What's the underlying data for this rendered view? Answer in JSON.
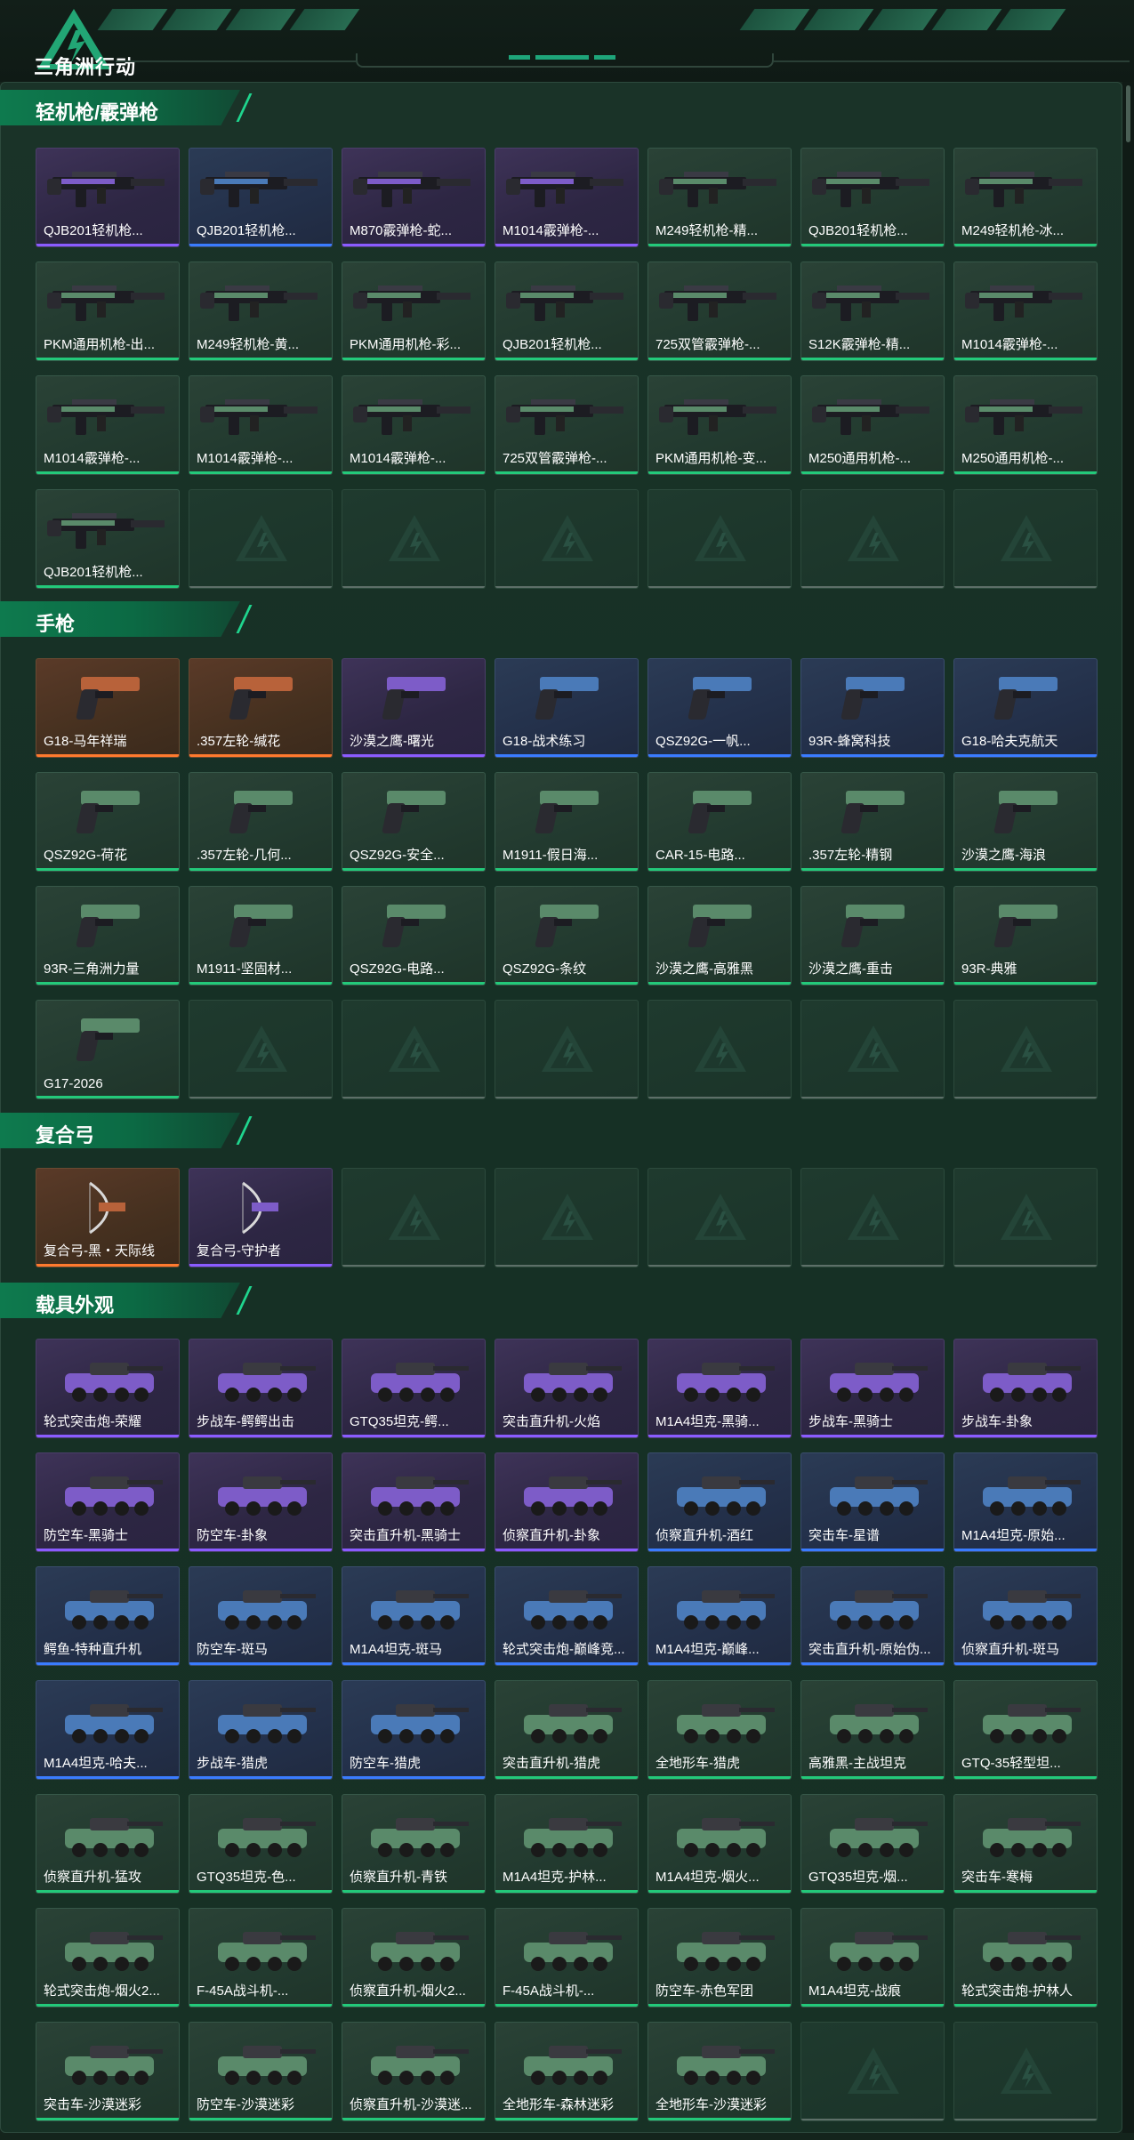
{
  "header": {
    "logo_text": "三角洲行动",
    "brand_color": "#1ea57a"
  },
  "rarity_colors": {
    "purple": "#8a5cff",
    "blue": "#3a7cff",
    "green": "#23c97a",
    "orange": "#ff7a2e"
  },
  "sections": [
    {
      "title": "轻机枪/霰弹枪",
      "icon": "gun-icon",
      "items": [
        {
          "name": "QJB201轻机枪...",
          "rarity": "purple"
        },
        {
          "name": "QJB201轻机枪...",
          "rarity": "blue"
        },
        {
          "name": "M870霰弹枪-蛇...",
          "rarity": "purple"
        },
        {
          "name": "M1014霰弹枪-...",
          "rarity": "purple"
        },
        {
          "name": "M249轻机枪-精...",
          "rarity": "green"
        },
        {
          "name": "QJB201轻机枪...",
          "rarity": "green"
        },
        {
          "name": "M249轻机枪-冰...",
          "rarity": "green"
        },
        {
          "name": "PKM通用机枪-出...",
          "rarity": "green"
        },
        {
          "name": "M249轻机枪-黄...",
          "rarity": "green"
        },
        {
          "name": "PKM通用机枪-彩...",
          "rarity": "green"
        },
        {
          "name": "QJB201轻机枪...",
          "rarity": "green"
        },
        {
          "name": "725双管霰弹枪-...",
          "rarity": "green"
        },
        {
          "name": "S12K霰弹枪-精...",
          "rarity": "green"
        },
        {
          "name": "M1014霰弹枪-...",
          "rarity": "green"
        },
        {
          "name": "M1014霰弹枪-...",
          "rarity": "green"
        },
        {
          "name": "M1014霰弹枪-...",
          "rarity": "green"
        },
        {
          "name": "M1014霰弹枪-...",
          "rarity": "green"
        },
        {
          "name": "725双管霰弹枪-...",
          "rarity": "green"
        },
        {
          "name": "PKM通用机枪-变...",
          "rarity": "green"
        },
        {
          "name": "M250通用机枪-...",
          "rarity": "green"
        },
        {
          "name": "M250通用机枪-...",
          "rarity": "green"
        },
        {
          "name": "QJB201轻机枪...",
          "rarity": "green"
        }
      ]
    },
    {
      "title": "手枪",
      "icon": "pistol-icon",
      "items": [
        {
          "name": "G18-马年祥瑞",
          "rarity": "orange"
        },
        {
          "name": ".357左轮-缄花",
          "rarity": "orange"
        },
        {
          "name": "沙漠之鹰-曙光",
          "rarity": "purple"
        },
        {
          "name": "G18-战术练习",
          "rarity": "blue"
        },
        {
          "name": "QSZ92G-一帆...",
          "rarity": "blue"
        },
        {
          "name": "93R-蜂窝科技",
          "rarity": "blue"
        },
        {
          "name": "G18-哈夫克航天",
          "rarity": "blue"
        },
        {
          "name": "QSZ92G-荷花",
          "rarity": "green"
        },
        {
          "name": ".357左轮-几何...",
          "rarity": "green"
        },
        {
          "name": "QSZ92G-安全...",
          "rarity": "green"
        },
        {
          "name": "M1911-假日海...",
          "rarity": "green"
        },
        {
          "name": "CAR-15-电路...",
          "rarity": "green"
        },
        {
          "name": ".357左轮-精钢",
          "rarity": "green"
        },
        {
          "name": "沙漠之鹰-海浪",
          "rarity": "green"
        },
        {
          "name": "93R-三角洲力量",
          "rarity": "green"
        },
        {
          "name": "M1911-坚固材...",
          "rarity": "green"
        },
        {
          "name": "QSZ92G-电路...",
          "rarity": "green"
        },
        {
          "name": "QSZ92G-条纹",
          "rarity": "green"
        },
        {
          "name": "沙漠之鹰-高雅黑",
          "rarity": "green"
        },
        {
          "name": "沙漠之鹰-重击",
          "rarity": "green"
        },
        {
          "name": "93R-典雅",
          "rarity": "green"
        },
        {
          "name": "G17-2026",
          "rarity": "green"
        }
      ]
    },
    {
      "title": "复合弓",
      "icon": "bow-icon",
      "items": [
        {
          "name": "复合弓-黑・天际线",
          "rarity": "orange"
        },
        {
          "name": "复合弓-守护者",
          "rarity": "purple"
        }
      ]
    },
    {
      "title": "载具外观",
      "icon": "vehicle-icon",
      "items": [
        {
          "name": "轮式突击炮-荣耀",
          "rarity": "purple"
        },
        {
          "name": "步战车-鳄鳄出击",
          "rarity": "purple"
        },
        {
          "name": "GTQ35坦克-鳄...",
          "rarity": "purple"
        },
        {
          "name": "突击直升机-火焰",
          "rarity": "purple"
        },
        {
          "name": "M1A4坦克-黑骑...",
          "rarity": "purple"
        },
        {
          "name": "步战车-黑骑士",
          "rarity": "purple"
        },
        {
          "name": "步战车-卦象",
          "rarity": "purple"
        },
        {
          "name": "防空车-黑骑士",
          "rarity": "purple"
        },
        {
          "name": "防空车-卦象",
          "rarity": "purple"
        },
        {
          "name": "突击直升机-黑骑士",
          "rarity": "purple"
        },
        {
          "name": "侦察直升机-卦象",
          "rarity": "purple"
        },
        {
          "name": "侦察直升机-酒红",
          "rarity": "blue"
        },
        {
          "name": "突击车-星谱",
          "rarity": "blue"
        },
        {
          "name": "M1A4坦克-原始...",
          "rarity": "blue"
        },
        {
          "name": "鳄鱼-特种直升机",
          "rarity": "blue"
        },
        {
          "name": "防空车-斑马",
          "rarity": "blue"
        },
        {
          "name": "M1A4坦克-斑马",
          "rarity": "blue"
        },
        {
          "name": "轮式突击炮-巅峰竞...",
          "rarity": "blue"
        },
        {
          "name": "M1A4坦克-巅峰...",
          "rarity": "blue"
        },
        {
          "name": "突击直升机-原始伪...",
          "rarity": "blue"
        },
        {
          "name": "侦察直升机-斑马",
          "rarity": "blue"
        },
        {
          "name": "M1A4坦克-哈夫...",
          "rarity": "blue"
        },
        {
          "name": "步战车-猎虎",
          "rarity": "blue"
        },
        {
          "name": "防空车-猎虎",
          "rarity": "blue"
        },
        {
          "name": "突击直升机-猎虎",
          "rarity": "green"
        },
        {
          "name": "全地形车-猎虎",
          "rarity": "green"
        },
        {
          "name": "高雅黑-主战坦克",
          "rarity": "green"
        },
        {
          "name": "GTQ-35轻型坦...",
          "rarity": "green"
        },
        {
          "name": "侦察直升机-猛攻",
          "rarity": "green"
        },
        {
          "name": "GTQ35坦克-色...",
          "rarity": "green"
        },
        {
          "name": "侦察直升机-青铁",
          "rarity": "green"
        },
        {
          "name": "M1A4坦克-护林...",
          "rarity": "green"
        },
        {
          "name": "M1A4坦克-烟火...",
          "rarity": "green"
        },
        {
          "name": "GTQ35坦克-烟...",
          "rarity": "green"
        },
        {
          "name": "突击车-寒梅",
          "rarity": "green"
        },
        {
          "name": "轮式突击炮-烟火2...",
          "rarity": "green"
        },
        {
          "name": "F-45A战斗机-...",
          "rarity": "green"
        },
        {
          "name": "侦察直升机-烟火2...",
          "rarity": "green"
        },
        {
          "name": "F-45A战斗机-...",
          "rarity": "green"
        },
        {
          "name": "防空车-赤色军团",
          "rarity": "green"
        },
        {
          "name": "M1A4坦克-战痕",
          "rarity": "green"
        },
        {
          "name": "轮式突击炮-护林人",
          "rarity": "green"
        },
        {
          "name": "突击车-沙漠迷彩",
          "rarity": "green"
        },
        {
          "name": "防空车-沙漠迷彩",
          "rarity": "green"
        },
        {
          "name": "侦察直升机-沙漠迷...",
          "rarity": "green"
        },
        {
          "name": "全地形车-森林迷彩",
          "rarity": "green"
        },
        {
          "name": "全地形车-沙漠迷彩",
          "rarity": "green"
        }
      ]
    }
  ]
}
